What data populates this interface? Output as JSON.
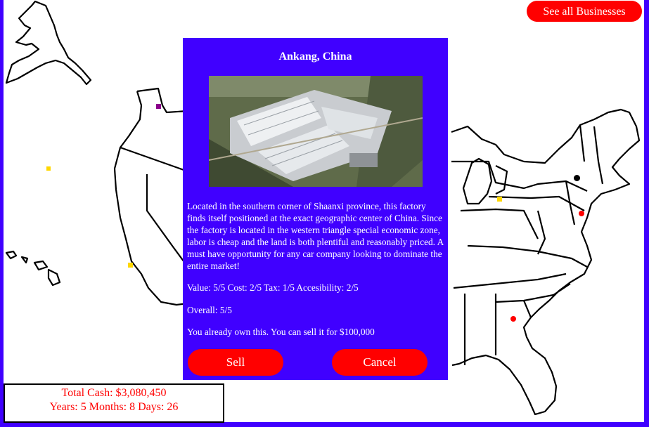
{
  "header": {
    "see_all_label": "See all Businesses"
  },
  "map": {
    "markers": [
      {
        "id": "purple-square",
        "color": "#8b008b",
        "shape": "square"
      },
      {
        "id": "yellow-square-pacific",
        "color": "#ffd700",
        "shape": "square"
      },
      {
        "id": "yellow-square-california",
        "color": "#ffd700",
        "shape": "square"
      },
      {
        "id": "yellow-square-michigan",
        "color": "#ffd700",
        "shape": "square"
      },
      {
        "id": "black-dot-newyork",
        "color": "#000000",
        "shape": "circle"
      },
      {
        "id": "red-dot-newjersey",
        "color": "#ff0000",
        "shape": "circle"
      },
      {
        "id": "red-dot-georgia",
        "color": "#ff0000",
        "shape": "circle"
      }
    ]
  },
  "modal": {
    "title": "Ankang, China",
    "photo_icon": "factory-aerial-photo",
    "description": "Located in the southern corner of Shaanxi province, this factory finds itself positioned at the exact geographic center of China. Since the factory is located in the western triangle special economic zone, labor is cheap and the land is both plentiful and reasonably priced. A must have opportunity for any car company looking to dominate the entire market!",
    "stats": "Value: 5/5 Cost: 2/5 Tax: 1/5 Accesibility: 2/5",
    "overall": "Overall: 5/5",
    "ownership": "You already own this. You can sell it for $100,000",
    "sell_label": "Sell",
    "cancel_label": "Cancel"
  },
  "status": {
    "cash": "Total Cash: $3,080,450",
    "time": "Years: 5 Months: 8 Days: 26"
  },
  "colors": {
    "background": "#4000ff",
    "button": "#ff0000",
    "status_text": "#ff0000"
  }
}
